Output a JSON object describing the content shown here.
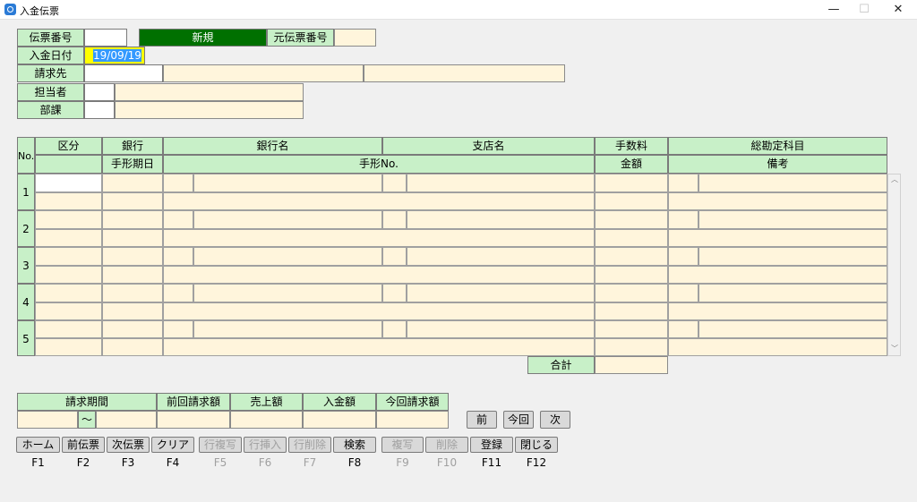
{
  "window": {
    "title": "入金伝票",
    "minimize": "—",
    "maximize": "☐",
    "close": "✕"
  },
  "header": {
    "denpyo_no_label": "伝票番号",
    "status": "新規",
    "orig_denpyo_label": "元伝票番号",
    "date_label": "入金日付",
    "date_value": "19/09/19",
    "customer_label": "請求先",
    "staff_label": "担当者",
    "dept_label": "部課"
  },
  "grid": {
    "no_label": "No.",
    "h1": [
      "区分",
      "銀行",
      "銀行名",
      "支店名",
      "手数料",
      "総勘定科目"
    ],
    "h2": [
      "手形期日",
      "手形No.",
      "金額",
      "備考"
    ],
    "rows": [
      "1",
      "2",
      "3",
      "4",
      "5"
    ],
    "total_label": "合計"
  },
  "summary": {
    "headers": [
      "請求期間",
      "前回請求額",
      "売上額",
      "入金額",
      "今回請求額"
    ],
    "tilde": "〜"
  },
  "nav": {
    "prev": "前",
    "current": "今回",
    "next": "次"
  },
  "fkeys": [
    {
      "label": "ホーム",
      "key": "F1",
      "enabled": true
    },
    {
      "label": "前伝票",
      "key": "F2",
      "enabled": true
    },
    {
      "label": "次伝票",
      "key": "F3",
      "enabled": true
    },
    {
      "label": "クリア",
      "key": "F4",
      "enabled": true
    },
    {
      "label": "行複写",
      "key": "F5",
      "enabled": false
    },
    {
      "label": "行挿入",
      "key": "F6",
      "enabled": false
    },
    {
      "label": "行削除",
      "key": "F7",
      "enabled": false
    },
    {
      "label": "検索",
      "key": "F8",
      "enabled": true
    },
    {
      "label": "複写",
      "key": "F9",
      "enabled": false
    },
    {
      "label": "削除",
      "key": "F10",
      "enabled": false
    },
    {
      "label": "登録",
      "key": "F11",
      "enabled": true
    },
    {
      "label": "閉じる",
      "key": "F12",
      "enabled": true
    }
  ],
  "colors": {
    "label_bg": "#c8f0c8",
    "input_bg": "#fff5dc",
    "status_bg": "#007000",
    "highlight": "#ffff00"
  }
}
